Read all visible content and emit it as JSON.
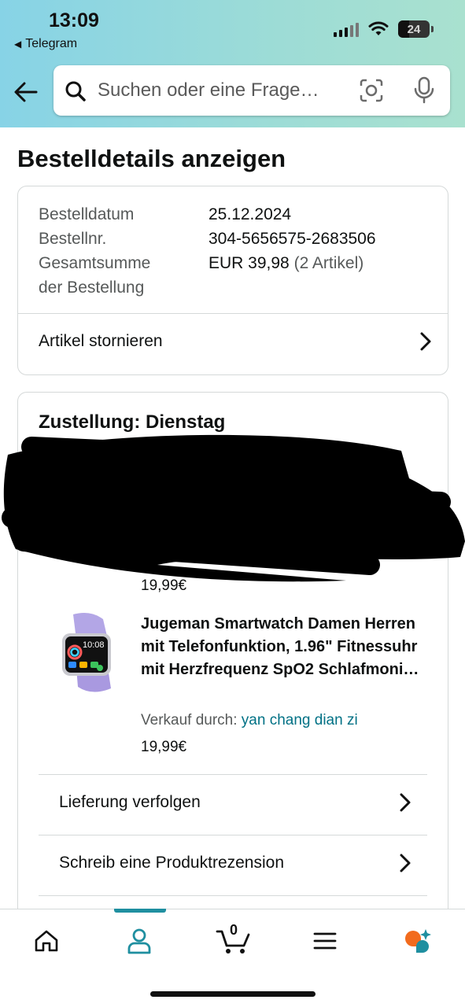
{
  "status_bar": {
    "time": "13:09",
    "back_app": "Telegram",
    "battery": "24"
  },
  "search": {
    "placeholder": "Suchen oder eine Frage…"
  },
  "page_title": "Bestelldetails anzeigen",
  "order": {
    "labels": [
      "Bestelldatum",
      "Bestellnr.",
      "Gesamtsumme der Bestellung"
    ],
    "date": "25.12.2024",
    "number": "304-5656575-2683506",
    "total": "EUR 39,98",
    "item_count": "(2 Artikel)",
    "cancel_label": "Artikel stornieren"
  },
  "delivery": {
    "heading": "Zustellung: Dienstag",
    "item1_price": "19,99€",
    "item2": {
      "title": "Jugeman Smartwatch Damen Herren mit Telefonfunktion, 1.96\" Fitnessuhr mit Herzfrequenz SpO2 Schlafmoni…",
      "seller_label": "Verkauf durch: ",
      "seller_name": "yan chang dian zi",
      "price": "19,99€",
      "watch_time": "10:08"
    },
    "actions": [
      "Lieferung verfolgen",
      "Schreib eine Produktrezension"
    ]
  },
  "tabbar": {
    "items": [
      "home-icon",
      "account-icon",
      "cart-icon",
      "menu-icon",
      "rufus-icon"
    ],
    "cart_count": "0",
    "accent": "#1f8fa0"
  },
  "colors": {
    "link": "#007185",
    "header_gradient": "#87d3e6"
  }
}
